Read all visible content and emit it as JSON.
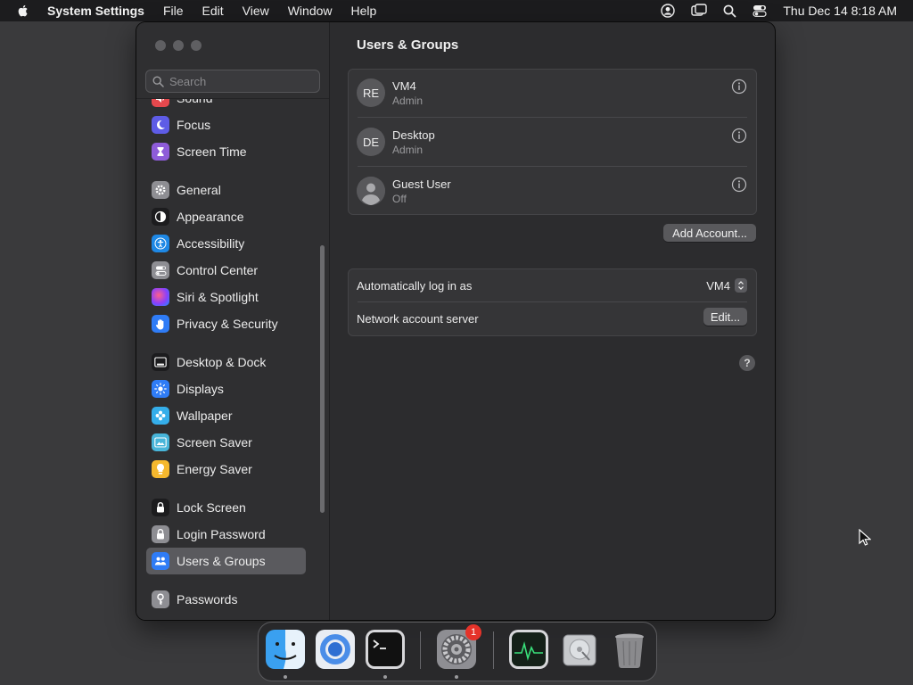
{
  "menubar": {
    "app_name": "System Settings",
    "menus": [
      "File",
      "Edit",
      "View",
      "Window",
      "Help"
    ],
    "clock": "Thu Dec 14  8:18 AM"
  },
  "sidebar": {
    "search_placeholder": "Search",
    "items": [
      {
        "label": "Sound",
        "icon": "sound-icon",
        "color": "#e5484d"
      },
      {
        "label": "Focus",
        "icon": "moon-icon",
        "color": "#5e5ce6"
      },
      {
        "label": "Screen Time",
        "icon": "hourglass-icon",
        "color": "#8e5cd9"
      },
      {
        "label": "General",
        "icon": "gear-icon",
        "color": "#8e8e93"
      },
      {
        "label": "Appearance",
        "icon": "appearance-icon",
        "color": "#1c1c1e"
      },
      {
        "label": "Accessibility",
        "icon": "accessibility-icon",
        "color": "#1e88e5"
      },
      {
        "label": "Control Center",
        "icon": "toggles-icon",
        "color": "#8e8e93"
      },
      {
        "label": "Siri & Spotlight",
        "icon": "siri-icon",
        "color": "#b43cc7"
      },
      {
        "label": "Privacy & Security",
        "icon": "hand-icon",
        "color": "#2f7cf6"
      },
      {
        "label": "Desktop & Dock",
        "icon": "dock-icon",
        "color": "#1c1c1e"
      },
      {
        "label": "Displays",
        "icon": "sun-icon",
        "color": "#2f7cf6"
      },
      {
        "label": "Wallpaper",
        "icon": "flower-icon",
        "color": "#35aeea"
      },
      {
        "label": "Screen Saver",
        "icon": "screensaver-icon",
        "color": "#48b5d9"
      },
      {
        "label": "Energy Saver",
        "icon": "bulb-icon",
        "color": "#f5b82e"
      },
      {
        "label": "Lock Screen",
        "icon": "lock-icon",
        "color": "#1c1c1e"
      },
      {
        "label": "Login Password",
        "icon": "lock-icon",
        "color": "#8e8e93"
      },
      {
        "label": "Users & Groups",
        "icon": "users-icon",
        "color": "#2f7cf6"
      },
      {
        "label": "Passwords",
        "icon": "key-icon",
        "color": "#8e8e93"
      }
    ],
    "selected": "Users & Groups"
  },
  "content": {
    "title": "Users & Groups",
    "users": [
      {
        "initials": "RE",
        "name": "VM4",
        "role": "Admin"
      },
      {
        "initials": "DE",
        "name": "Desktop",
        "role": "Admin"
      },
      {
        "initials": "",
        "name": "Guest User",
        "role": "Off"
      }
    ],
    "add_account_label": "Add Account...",
    "auto_login_label": "Automatically log in as",
    "auto_login_value": "VM4",
    "network_server_label": "Network account server",
    "edit_label": "Edit...",
    "help_label": "?"
  },
  "dock": {
    "apps": [
      {
        "name": "finder-icon",
        "running": true
      },
      {
        "name": "chromium-icon",
        "running": false
      },
      {
        "name": "terminal-icon",
        "running": true
      },
      {
        "name": "system-settings-icon",
        "running": true,
        "badge": "1"
      },
      {
        "name": "activity-monitor-icon",
        "running": false
      },
      {
        "name": "disk-utility-icon",
        "running": false
      },
      {
        "name": "trash-icon",
        "running": false
      }
    ]
  }
}
